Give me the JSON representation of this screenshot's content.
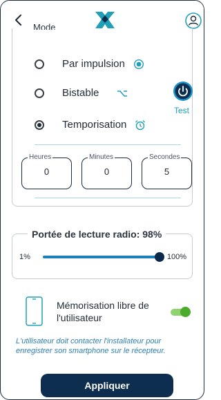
{
  "header": {
    "back_icon": "chevron-left-icon",
    "logo_icon": "brand-logo",
    "user_icon": "user-circle-icon"
  },
  "mode_section": {
    "title": "Mode",
    "options": [
      {
        "label": "Par impulsion",
        "checked": false,
        "icon": "pulse-dot-icon"
      },
      {
        "label": "Bistable",
        "checked": false,
        "icon": "bistable-switch-icon"
      },
      {
        "label": "Temporisation",
        "checked": true,
        "icon": "alarm-clock-icon"
      }
    ],
    "test_label": "Test",
    "duration_fields": [
      {
        "legend": "Heures",
        "value": "0"
      },
      {
        "legend": "Minutes",
        "value": "0"
      },
      {
        "legend": "Secondes",
        "value": "5"
      }
    ]
  },
  "range_section": {
    "title": "Portée de lecture radio: 98%",
    "min_label": "1%",
    "max_label": "100%",
    "value_percent": 98
  },
  "memo": {
    "label": "Mémorisation libre de l'utilisateur",
    "enabled": true,
    "info": "L'utilisateur doit contacter l'installateur pour enregistrer son smartphone sur le récepteur."
  },
  "apply_label": "Appliquer",
  "colors": {
    "accent": "#1fa0b6",
    "dark": "#0d2e4e",
    "toggle_on": "#4bab2a",
    "info_text": "#2a7fb8"
  }
}
